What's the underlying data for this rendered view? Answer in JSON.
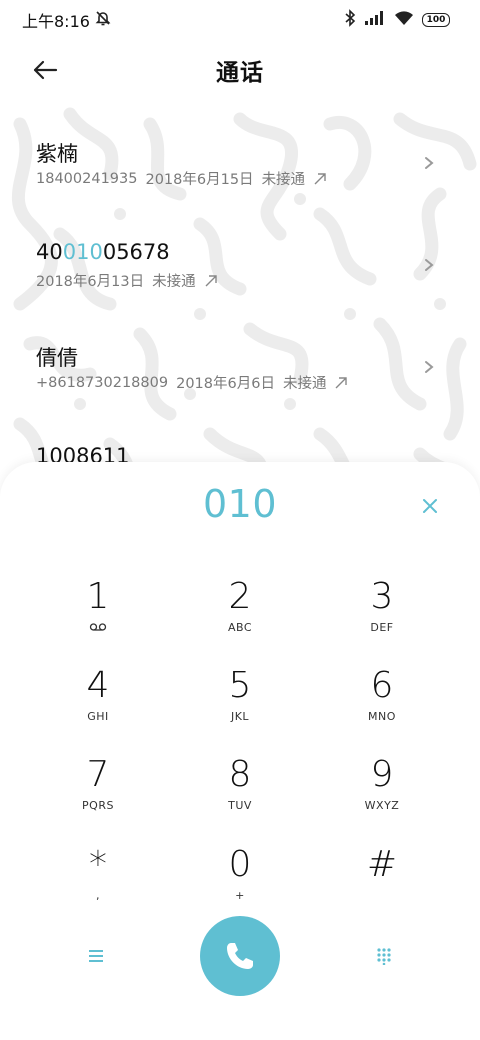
{
  "status_bar": {
    "time": "上午8:16",
    "battery": "100"
  },
  "header": {
    "title": "通话"
  },
  "calls": [
    {
      "name": "紫楠",
      "number": "18400241935",
      "date": "2018年6月15日",
      "status": "未接通"
    },
    {
      "name_prefix": "40",
      "name_highlight": "010",
      "name_suffix": "05678",
      "date": "2018年6月13日",
      "status": "未接通"
    },
    {
      "name": "倩倩",
      "number": "+8618730218809",
      "date": "2018年6月6日",
      "status": "未接通"
    },
    {
      "name": "1008611"
    }
  ],
  "dialpad": {
    "input": "010",
    "keys": [
      {
        "digit": "1",
        "sub": ""
      },
      {
        "digit": "2",
        "sub": "ABC"
      },
      {
        "digit": "3",
        "sub": "DEF"
      },
      {
        "digit": "4",
        "sub": "GHI"
      },
      {
        "digit": "5",
        "sub": "JKL"
      },
      {
        "digit": "6",
        "sub": "MNO"
      },
      {
        "digit": "7",
        "sub": "PQRS"
      },
      {
        "digit": "8",
        "sub": "TUV"
      },
      {
        "digit": "9",
        "sub": "WXYZ"
      },
      {
        "digit": "*",
        "sub": ","
      },
      {
        "digit": "0",
        "sub": "+"
      },
      {
        "digit": "#",
        "sub": ""
      }
    ]
  },
  "colors": {
    "accent": "#5fbfd2",
    "text": "#111111",
    "secondary_text": "#7a7a7a"
  }
}
